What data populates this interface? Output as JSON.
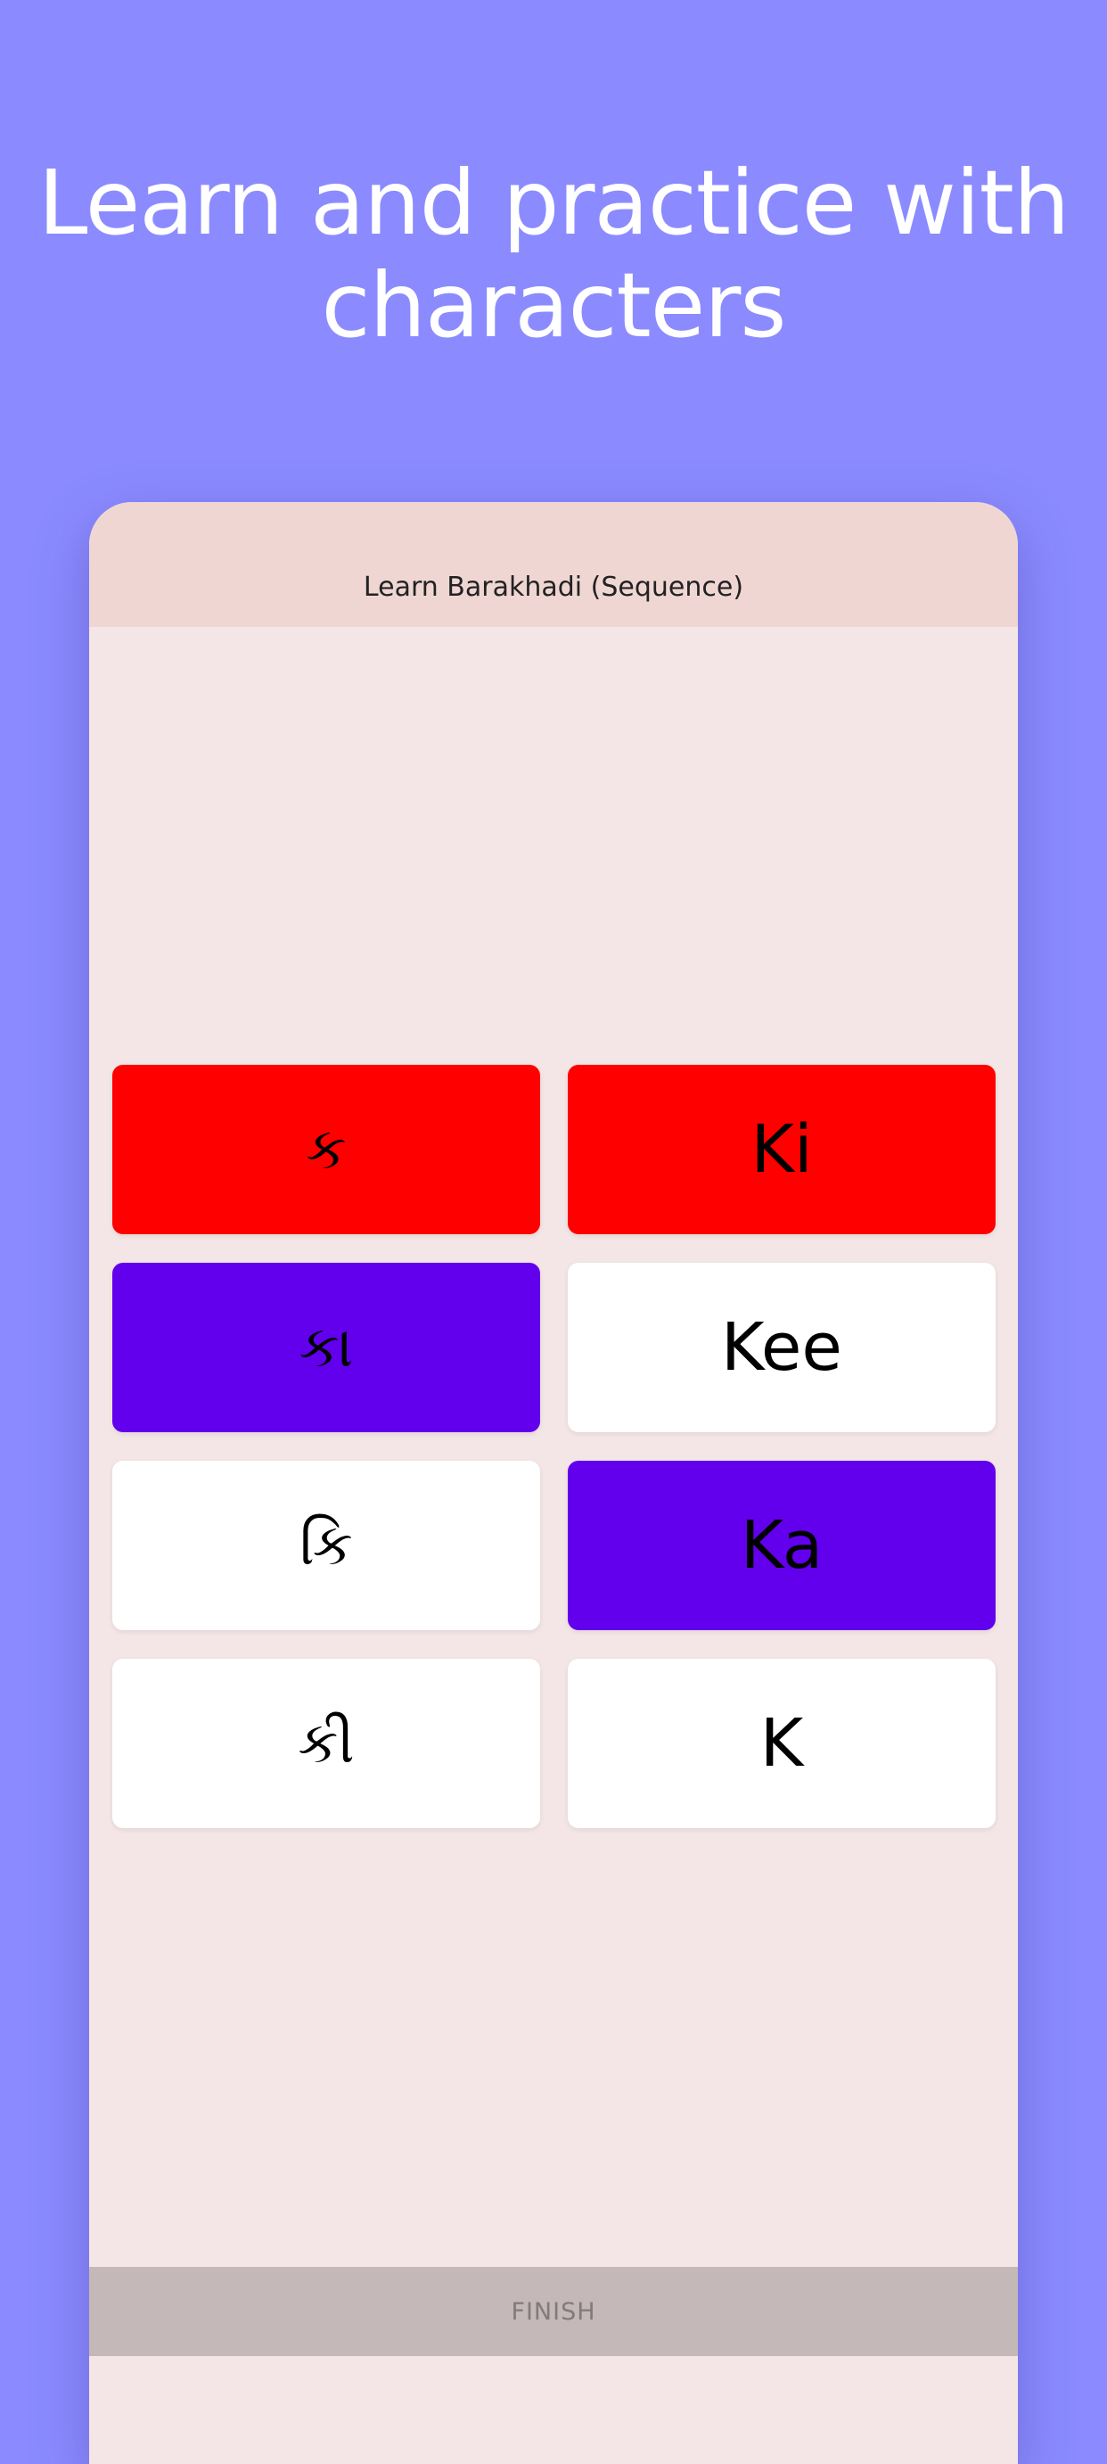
{
  "headline": {
    "line1": "Learn and practice with",
    "line2": "characters"
  },
  "app": {
    "title": "Learn Barakhadi (Sequence)",
    "finish_label": "FINISH"
  },
  "tiles": [
    {
      "label": "ક",
      "state": "wrong",
      "color": "#ff0000"
    },
    {
      "label": "Ki",
      "state": "wrong",
      "color": "#ff0000"
    },
    {
      "label": "કા",
      "state": "matched",
      "color": "#6200ee"
    },
    {
      "label": "Kee",
      "state": "default",
      "color": "#ffffff"
    },
    {
      "label": "કિ",
      "state": "default",
      "color": "#ffffff"
    },
    {
      "label": "Ka",
      "state": "matched",
      "color": "#6200ee"
    },
    {
      "label": "કી",
      "state": "default",
      "color": "#ffffff"
    },
    {
      "label": "K",
      "state": "default",
      "color": "#ffffff"
    }
  ],
  "colors": {
    "page_background": "#8b8bff",
    "card_background": "#f4e6e6",
    "header_background": "#f0d6d3",
    "wrong": "#ff0000",
    "matched": "#6200ee",
    "finish_bar": "#c4b8b8"
  }
}
